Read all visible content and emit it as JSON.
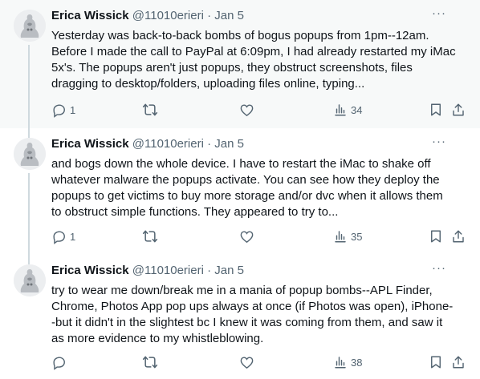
{
  "tweets": [
    {
      "author_name": "Erica Wissick",
      "handle": "@11010erieri",
      "separator": "·",
      "date": "Jan 5",
      "more_label": "···",
      "lines": [
        "Yesterday was back-to-back bombs of bogus popups from 1pm--12am.",
        "Before I made the call to PayPal at 6:09pm, I had already restarted my iMac",
        "5x's. The popups aren't just popups, they obstruct screenshots, files",
        "dragging to desktop/folders, uploading files online, typing..."
      ],
      "reply_count": "1",
      "retweet_count": "",
      "like_count": "",
      "views": "34"
    },
    {
      "author_name": "Erica Wissick",
      "handle": "@11010erieri",
      "separator": "·",
      "date": "Jan 5",
      "more_label": "···",
      "lines": [
        "and bogs down the whole device. I have to restart the iMac to shake off",
        "whatever malware the popups activate. You can see how they deploy the",
        "popups to get victims to buy more storage and/or dvc when it allows them",
        "to obstruct simple functions. They appeared to try to..."
      ],
      "reply_count": "1",
      "retweet_count": "",
      "like_count": "",
      "views": "35"
    },
    {
      "author_name": "Erica Wissick",
      "handle": "@11010erieri",
      "separator": "·",
      "date": "Jan 5",
      "more_label": "···",
      "lines": [
        "try to wear me down/break me in a mania of popup bombs--APL Finder,",
        "Chrome, Photos App pop ups always at once (if Photos was open), iPhone-",
        "-but it didn't in the slightest bc I knew it was coming from them, and saw it",
        "as more evidence to my whistleblowing."
      ],
      "reply_count": "",
      "retweet_count": "",
      "like_count": "",
      "views": "38"
    }
  ],
  "icons": {
    "reply": "reply-icon",
    "retweet": "retweet-icon",
    "like": "like-icon",
    "views": "views-icon",
    "bookmark": "bookmark-icon",
    "share": "share-icon"
  },
  "colors": {
    "text": "#0f1419",
    "secondary": "#536471",
    "highlight_bg": "#f7f9f9",
    "thread_line": "#cfd9de"
  }
}
